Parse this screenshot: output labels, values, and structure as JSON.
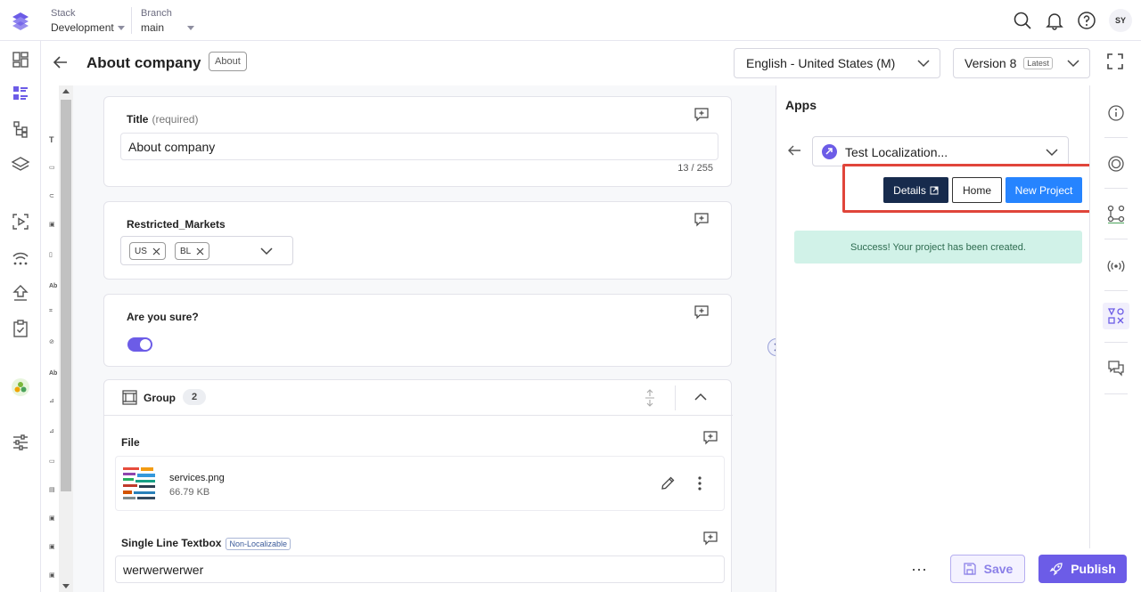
{
  "header": {
    "stack_label": "Stack",
    "stack_value": "Development",
    "branch_label": "Branch",
    "branch_value": "main",
    "avatar_initials": "SY"
  },
  "entry": {
    "title": "About company",
    "content_type_badge": "About",
    "locale": "English - United States (M)",
    "version": "Version 8",
    "version_tag": "Latest"
  },
  "field_type_strip": [
    "T",
    "Ab",
    "Ab"
  ],
  "fields": {
    "title": {
      "label": "Title",
      "required_text": "(required)",
      "value": "About company",
      "counter": "13 / 255"
    },
    "restricted_markets": {
      "label": "Restricted_Markets",
      "tags": [
        "US",
        "BL"
      ]
    },
    "are_you_sure": {
      "label": "Are you sure?",
      "toggle_on": true
    },
    "group": {
      "label": "Group",
      "count": "2",
      "file_label": "File",
      "file_name": "services.png",
      "file_size": "66.79 KB",
      "single_line_label": "Single Line Textbox",
      "single_line_badge": "Non-Localizable",
      "single_line_value": "werwerwerwer"
    }
  },
  "apps_panel": {
    "title": "Apps",
    "app_name": "Test Localization...",
    "details_button": "Details",
    "home_button": "Home",
    "new_project_button": "New Project",
    "success_message": "Success! Your project has been created."
  },
  "actions": {
    "more": "⋯",
    "save": "Save",
    "publish": "Publish"
  },
  "colors": {
    "primary": "#6c5ce7",
    "details_bg": "#172b4d",
    "new_project_bg": "#2684ff",
    "success_bg": "#d1f2e8",
    "highlight": "#e0453a"
  }
}
